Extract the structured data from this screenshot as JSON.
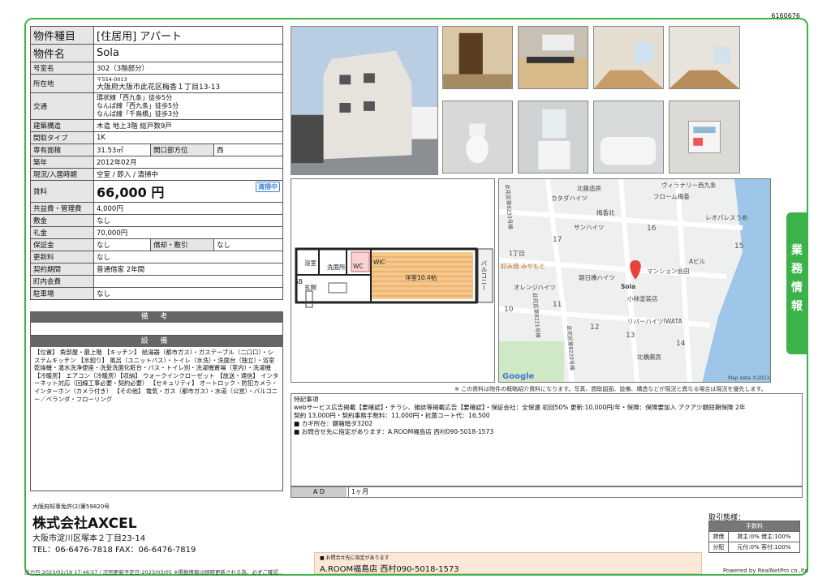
{
  "doc_id": "6160676",
  "rows": {
    "type_label": "物件種目",
    "type_value": "[住居用] アパート",
    "name_label": "物件名",
    "name_value": "Sola",
    "room_label": "号室名",
    "room_value": "302（3階部分）",
    "addr_label": "所在地",
    "zip": "〒554-0013",
    "addr_value": "大阪府大阪市此花区梅香１丁目13-13",
    "traffic_label": "交通",
    "traffic_1": "環状線「西九条」徒歩5分",
    "traffic_2": "なんば線「西九条」徒歩5分",
    "traffic_3": "なんば線「千鳥橋」徒歩3分",
    "struct_label": "建築構造",
    "struct_value": "木造 地上3階 総戸数9戸",
    "layout_label": "間取タイプ",
    "layout_value": "1K",
    "area_label": "専有面積",
    "area_value": "31.53㎡",
    "opening_label": "開口部方位",
    "opening_value": "西",
    "built_label": "築年",
    "built_value": "2012年02月",
    "status_label": "現況/入居時期",
    "status_value": "空室 / 即入 / 清掃中",
    "rent_label": "賃料",
    "rent_value": "66,000 円",
    "rent_badge": "清掃中",
    "common_label": "共益費・管理費",
    "common_value": "4,000円",
    "deposit_label": "敷金",
    "deposit_value": "なし",
    "key_label": "礼金",
    "key_value": "70,000円",
    "hoshokin_label": "保証金",
    "hoshokin_value": "なし",
    "shokyaku_label": "償却・敷引",
    "shokyaku_value": "なし",
    "renew_label": "更新料",
    "renew_value": "なし",
    "contract_label": "契約期間",
    "contract_value": "普通借家 2年間",
    "town_label": "町内会費",
    "town_value": "",
    "parking_label": "駐車場",
    "parking_value": "なし"
  },
  "biko_title": "備 考",
  "setsubi_title": "設 備",
  "equipment": "【位置】 角部屋・最上階 【キッチン】 給湯器（都市ガス）・ガステーブル（二口口）・システムキッチン 【水廻り】 風呂（ユニットバス）・トイレ（水洗）・洗面台（独立）・浴室乾燥機・温水洗浄便座・洗髪洗面化粧台・バス・トイレ別・洗濯機置場（室内）・洗濯機 【冷暖房】 エアコン（冷暖房）【収納】 ウォークインクローゼット 【放送・通信】 インターネット対応（回線工事必要・契約必要） 【セキュリティ】 オートロック・防犯カメラ・インターホン（カメラ付き） 【その他】 電気・ガス（都市ガス）・水道（公営）・バルコニー／ベランダ・フローリング",
  "plan": {
    "room_label": "洋室10.4帖",
    "bath": "浴室",
    "wash": "洗面所",
    "wc": "WC",
    "wic": "WIC",
    "entrance": "玄関",
    "shoes": "SB",
    "balcony": "バルコニー"
  },
  "map": {
    "labels": [
      "ヴィラナリー西九条",
      "北藤造房",
      "カタダハイツ",
      "フローム梅香",
      "梅香北",
      "レオパレスうめ",
      "サンハイツ",
      "1丁目",
      "好み焼 みやもと",
      "朝日橋ハイツ",
      "マンション会田",
      "Aビル",
      "オレンジハイツ",
      "Sola",
      "小林塗装店",
      "リバーハイツIWATA",
      "北橋薬房",
      "此花区第8221号線",
      "此花区第8220号線",
      "此花区第8233号線",
      "Google",
      "Map data ©2023"
    ],
    "numbers": [
      "17",
      "16",
      "15",
      "10",
      "11",
      "12",
      "13",
      "14"
    ]
  },
  "note": "※ この資料は物件の概略紹介資料になります。写真、間取図面、設備、構造などが現況と異なる場合は現況を優先します。",
  "tokki_title": "特記事項",
  "tokki_lines": [
    "webサービス広告掲載【要確認】・チラシ、雑誌等掲載広告【要確認】・保証会社：全保連 初回50% 更新:10,000円/年・保険：保険要加入 アクア少額短期保険 2年",
    "契約 13,000円・契約事務手数料：11,000円・抗菌コート代：16,500",
    "■ カギ所在：鍵箱暗ダ3202",
    "■ お問合せ先に指定があります：A.ROOM福島店 西村090-5018-1573"
  ],
  "ad_label": "A D",
  "ad_value": "1ヶ月",
  "sidetab": [
    "業",
    "務",
    "情",
    "報"
  ],
  "company": {
    "license": "大阪府知事免許(2)第59820号",
    "name": "株式会社AXCEL",
    "address": "大阪市淀川区塚本２丁目23-14",
    "tel": "TEL：06-6476-7818 FAX：06-6476-7819"
  },
  "agency": {
    "line1": "■ お問合せ先に指定があります",
    "line2": "A.ROOM福島店 西村090-5018-1573"
  },
  "torihiki": {
    "label": "取引態様：",
    "header": "手数料",
    "row1_label": "貸借",
    "row1_a": "貸主:0% 借主:100%",
    "row2_label": "分配",
    "row2_a": "元付:0% 客付:100%"
  },
  "footer": "出力日:2023/02/19 17:46:57 / 次回更新予定日:2023/03/05 ※掲載情報は随時更新される為、必ずご確認...",
  "powered": "Powered by RealNetPro co.,ltd"
}
